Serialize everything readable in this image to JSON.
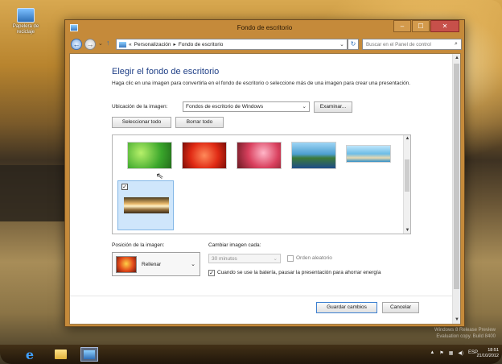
{
  "desktop": {
    "icon_label": "Papelera de reciclaje"
  },
  "window": {
    "title": "Fondo de escritorio",
    "controls": {
      "minimize": "–",
      "maximize": "☐",
      "close": "✕"
    }
  },
  "navbar": {
    "back": "←",
    "forward": "→",
    "dropdown": "⌄",
    "up": "↑",
    "address_prefix": "«",
    "breadcrumb": [
      "Personalización",
      "Fondo de escritorio"
    ],
    "separator": "▸",
    "address_dropdown": "⌄",
    "refresh": "↻",
    "search_placeholder": "Buscar en el Panel de control",
    "search_icon": "⌕"
  },
  "content": {
    "heading": "Elegir el fondo de escritorio",
    "description": "Haga clic en una imagen para convertirla en el fondo de escritorio o seleccione más de una imagen para crear una presentación.",
    "location_label": "Ubicación de la imagen:",
    "location_value": "Fondos de escritorio de Windows",
    "browse_button": "Examinar...",
    "select_all_button": "Seleccionar todo",
    "clear_all_button": "Borrar todo",
    "selected_check": "✓",
    "position_label": "Posición de la imagen:",
    "position_value": "Rellenar",
    "change_label": "Cambiar imagen cada:",
    "interval_value": "30 minutos",
    "shuffle_label": "Orden aleatorio",
    "battery_label": "Cuando se use la batería, pausar la presentación para ahorrar energía",
    "battery_check": "✓",
    "save_button": "Guardar cambios",
    "cancel_button": "Cancelar"
  },
  "taskbar": {
    "tray_lang": "ESP",
    "clock_time": "18:51",
    "clock_date": "21/10/2012"
  },
  "watermark": {
    "line1": "Windows 8 Release Preview",
    "line2": "Evaluation copy. Build 8400"
  }
}
